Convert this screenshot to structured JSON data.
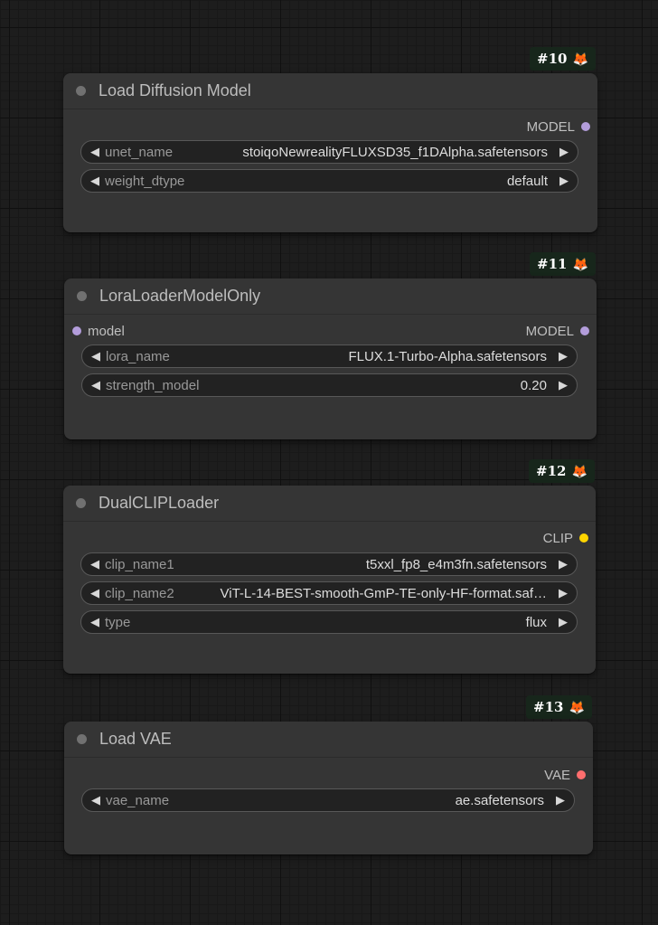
{
  "colors": {
    "canvas_bg": "#1d1d1d",
    "node_bg": "#353535",
    "widget_bg": "#222222",
    "badge_bg": "#17261b",
    "model_slot": "#b39ddb",
    "clip_slot": "#ffd500",
    "vae_slot": "#ff6e6e"
  },
  "nodes": [
    {
      "badge": {
        "id": "#10",
        "icon": "🦊"
      },
      "title": "Load Diffusion Model",
      "output": {
        "label": "MODEL",
        "icon": "model-slot-dot"
      },
      "widgets": [
        {
          "label": "unet_name",
          "value": "stoiqoNewrealityFLUXSD35_f1DAlpha.safetensors"
        },
        {
          "label": "weight_dtype",
          "value": "default"
        }
      ]
    },
    {
      "badge": {
        "id": "#11",
        "icon": "🦊"
      },
      "title": "LoraLoaderModelOnly",
      "input": {
        "label": "model",
        "icon": "model-slot-dot"
      },
      "output": {
        "label": "MODEL",
        "icon": "model-slot-dot"
      },
      "widgets": [
        {
          "label": "lora_name",
          "value": "FLUX.1-Turbo-Alpha.safetensors"
        },
        {
          "label": "strength_model",
          "value": "0.20"
        }
      ]
    },
    {
      "badge": {
        "id": "#12",
        "icon": "🦊"
      },
      "title": "DualCLIPLoader",
      "output": {
        "label": "CLIP",
        "icon": "clip-slot-dot"
      },
      "widgets": [
        {
          "label": "clip_name1",
          "value": "t5xxl_fp8_e4m3fn.safetensors"
        },
        {
          "label": "clip_name2",
          "value": "ViT-L-14-BEST-smooth-GmP-TE-only-HF-format.saf…"
        },
        {
          "label": "type",
          "value": "flux"
        }
      ]
    },
    {
      "badge": {
        "id": "#13",
        "icon": "🦊"
      },
      "title": "Load VAE",
      "output": {
        "label": "VAE",
        "icon": "vae-slot-dot"
      },
      "widgets": [
        {
          "label": "vae_name",
          "value": "ae.safetensors"
        }
      ]
    }
  ],
  "arrows": {
    "left": "◀",
    "right": "▶"
  }
}
